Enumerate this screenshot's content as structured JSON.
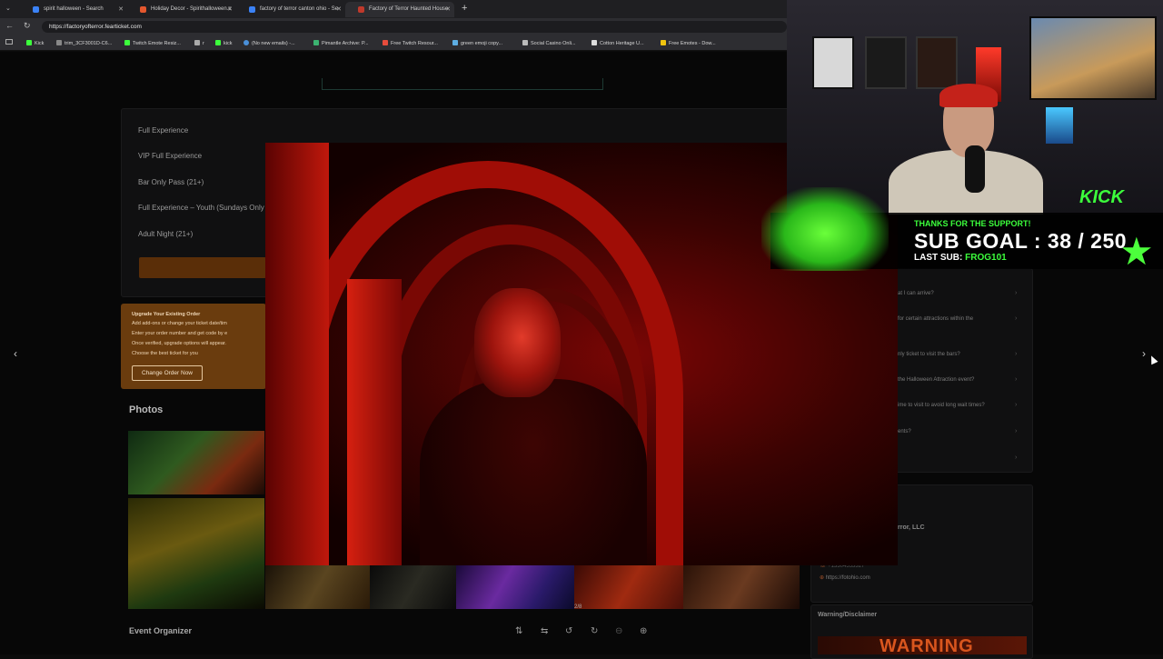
{
  "browser": {
    "tabs": [
      {
        "label": "spirit halloween - Search",
        "color": "#3b82f6"
      },
      {
        "label": "Holiday Decor - Spirithalloween.c",
        "color": "#e4572e"
      },
      {
        "label": "factory of terror canton ohio - Se",
        "color": "#3b82f6"
      },
      {
        "label": "Factory of Terror Haunted House",
        "color": "#c0392b"
      }
    ],
    "new_tab": "+",
    "url": "https://factoryofterror.fearticket.com",
    "bookmarks": [
      "Kick",
      "trim_3CF3001D-C6...",
      "Twitch Emote Resiz...",
      "r",
      "kick",
      "(No new emails) -...",
      "Pimantle Archive: P...",
      "Free Twitch Resour...",
      "green emoji copy...",
      "Social Casino Onli...",
      "Cotton Heritage U...",
      "Free Emotes - Dow..."
    ]
  },
  "tickets": [
    "Full Experience",
    "VIP Full Experience",
    "Bar Only Pass (21+)",
    "Full Experience – Youth (Sundays Only",
    "Adult Night (21+)"
  ],
  "upgrade": {
    "title": "Upgrade Your Existing Order",
    "bullets": [
      "Add add-ons or change your ticket date/tim",
      "Enter your order number and get code by e",
      "Once verified, upgrade options will appear.",
      "Choose the best ticket for you"
    ],
    "button": "Change Order Now"
  },
  "photos_title": "Photos",
  "organizer_title": "Event Organizer",
  "faq": [
    "at I can arrive?",
    "for certain attractions within the",
    "nly ticket to visit the bars?",
    "the Halloween Attraction event?",
    "ime to visit to avoid long wait times?",
    "ents?"
  ],
  "organizer": {
    "name": "rror, LLC",
    "phone": "+13304553327",
    "website": "https://fotohio.com"
  },
  "warning_title": "Warning/Disclaimer",
  "warning_banner": "WARNING",
  "lightbox": {
    "counter": "2/8",
    "prev": "‹",
    "next": "›"
  },
  "overlay": {
    "thanks": "THANKS FOR THE SUPPORT!",
    "goal": "SUB GOAL : 38 / 250",
    "lastsub_label": "LAST SUB:",
    "lastsub_name": "FROG101",
    "kick": "KICK",
    "accent": "#3cff3c"
  }
}
